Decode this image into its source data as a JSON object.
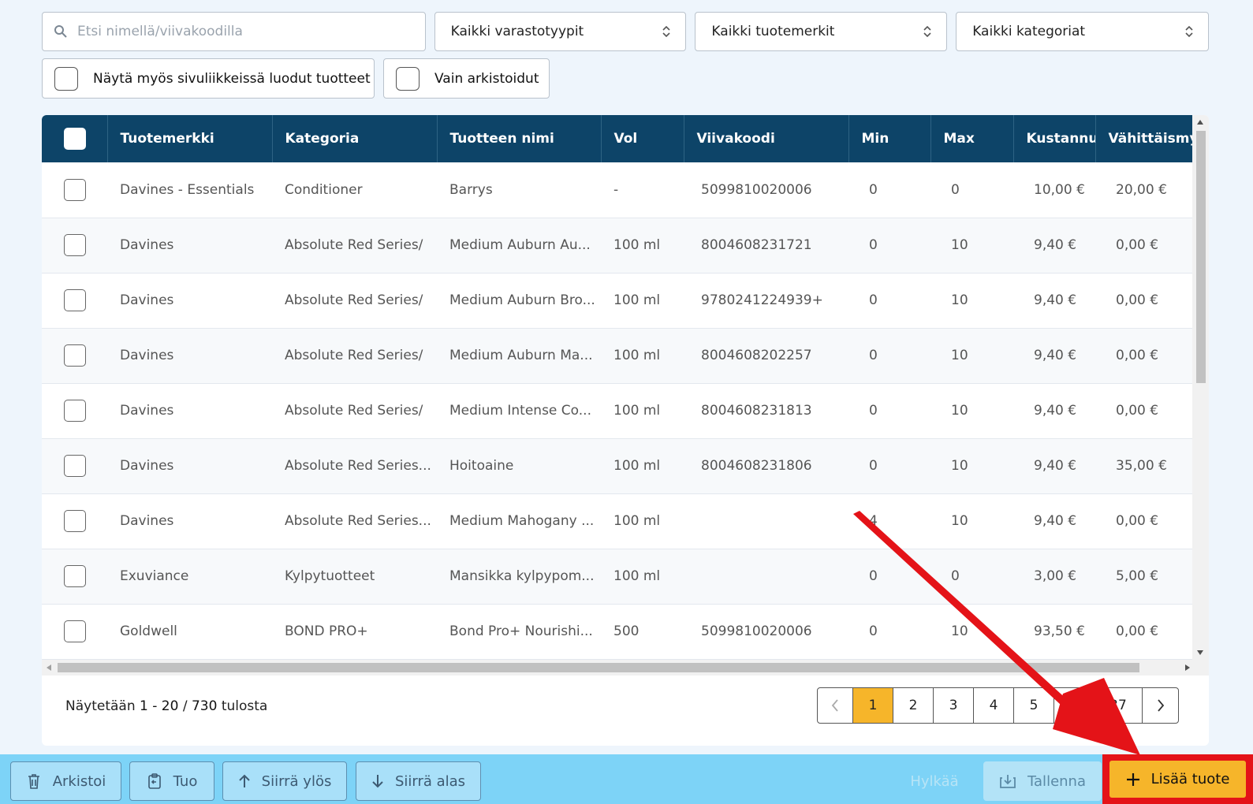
{
  "filters": {
    "search_placeholder": "Etsi nimellä/viivakoodilla",
    "stock_type": "Kaikki varastotyypit",
    "brand": "Kaikki tuotemerkit",
    "category": "Kaikki kategoriat",
    "show_subpage_label": "Näytä myös sivuliikkeissä luodut tuotteet",
    "archived_only_label": "Vain arkistoidut"
  },
  "table": {
    "headers": [
      "Tuotemerkki",
      "Kategoria",
      "Tuotteen nimi",
      "Vol",
      "Viivakoodi",
      "Min",
      "Max",
      "Kustannus",
      "Vähittäismy"
    ],
    "rows": [
      [
        "Davines - Essentials",
        "Conditioner",
        "Barrys",
        "-",
        "5099810020006",
        "0",
        "0",
        "10,00 €",
        "20,00 €"
      ],
      [
        "Davines",
        "Absolute Red Series/",
        "Medium Auburn Au...",
        "100 ml",
        "8004608231721",
        "0",
        "10",
        "9,40 €",
        "0,00 €"
      ],
      [
        "Davines",
        "Absolute Red Series/",
        "Medium Auburn Bro...",
        "100 ml",
        "9780241224939+",
        "0",
        "10",
        "9,40 €",
        "0,00 €"
      ],
      [
        "Davines",
        "Absolute Red Series/",
        "Medium Auburn Ma...",
        "100 ml",
        "8004608202257",
        "0",
        "10",
        "9,40 €",
        "0,00 €"
      ],
      [
        "Davines",
        "Absolute Red Series/",
        "Medium Intense Co...",
        "100 ml",
        "8004608231813",
        "0",
        "10",
        "9,40 €",
        "0,00 €"
      ],
      [
        "Davines",
        "Absolute Red Series...",
        "Hoitoaine",
        "100 ml",
        "8004608231806",
        "0",
        "10",
        "9,40 €",
        "35,00 €"
      ],
      [
        "Davines",
        "Absolute Red Series...",
        "Medium Mahogany ...",
        "100 ml",
        "",
        "4",
        "10",
        "9,40 €",
        "0,00 €"
      ],
      [
        "Exuviance",
        "Kylpytuotteet",
        "Mansikka kylpypom...",
        "100 ml",
        "",
        "0",
        "0",
        "3,00 €",
        "5,00 €"
      ],
      [
        "Goldwell",
        "BOND PRO+",
        "Bond Pro+ Nourishi...",
        "500",
        "5099810020006",
        "0",
        "10",
        "93,50 €",
        "0,00 €"
      ],
      [
        "",
        "",
        "",
        "",
        "",
        "",
        "",
        "",
        ""
      ]
    ]
  },
  "pager": {
    "prefix": "Näytetään",
    "range": "1 - 20",
    "sep": "/",
    "total": "730",
    "suffix": "tulosta",
    "pages": [
      "1",
      "2",
      "3",
      "4",
      "5",
      "...",
      "37"
    ],
    "active": "1"
  },
  "footer": {
    "archive": "Arkistoi",
    "import": "Tuo",
    "move_up": "Siirrä ylös",
    "move_down": "Siirrä alas",
    "discard": "Hylkää",
    "save": "Tallenna",
    "add_product": "Lisää tuote"
  },
  "colors": {
    "header_bg": "#0d4468",
    "footer_bg": "#7dd3f7",
    "accent": "#f6b52a",
    "annotation": "#e41318"
  }
}
